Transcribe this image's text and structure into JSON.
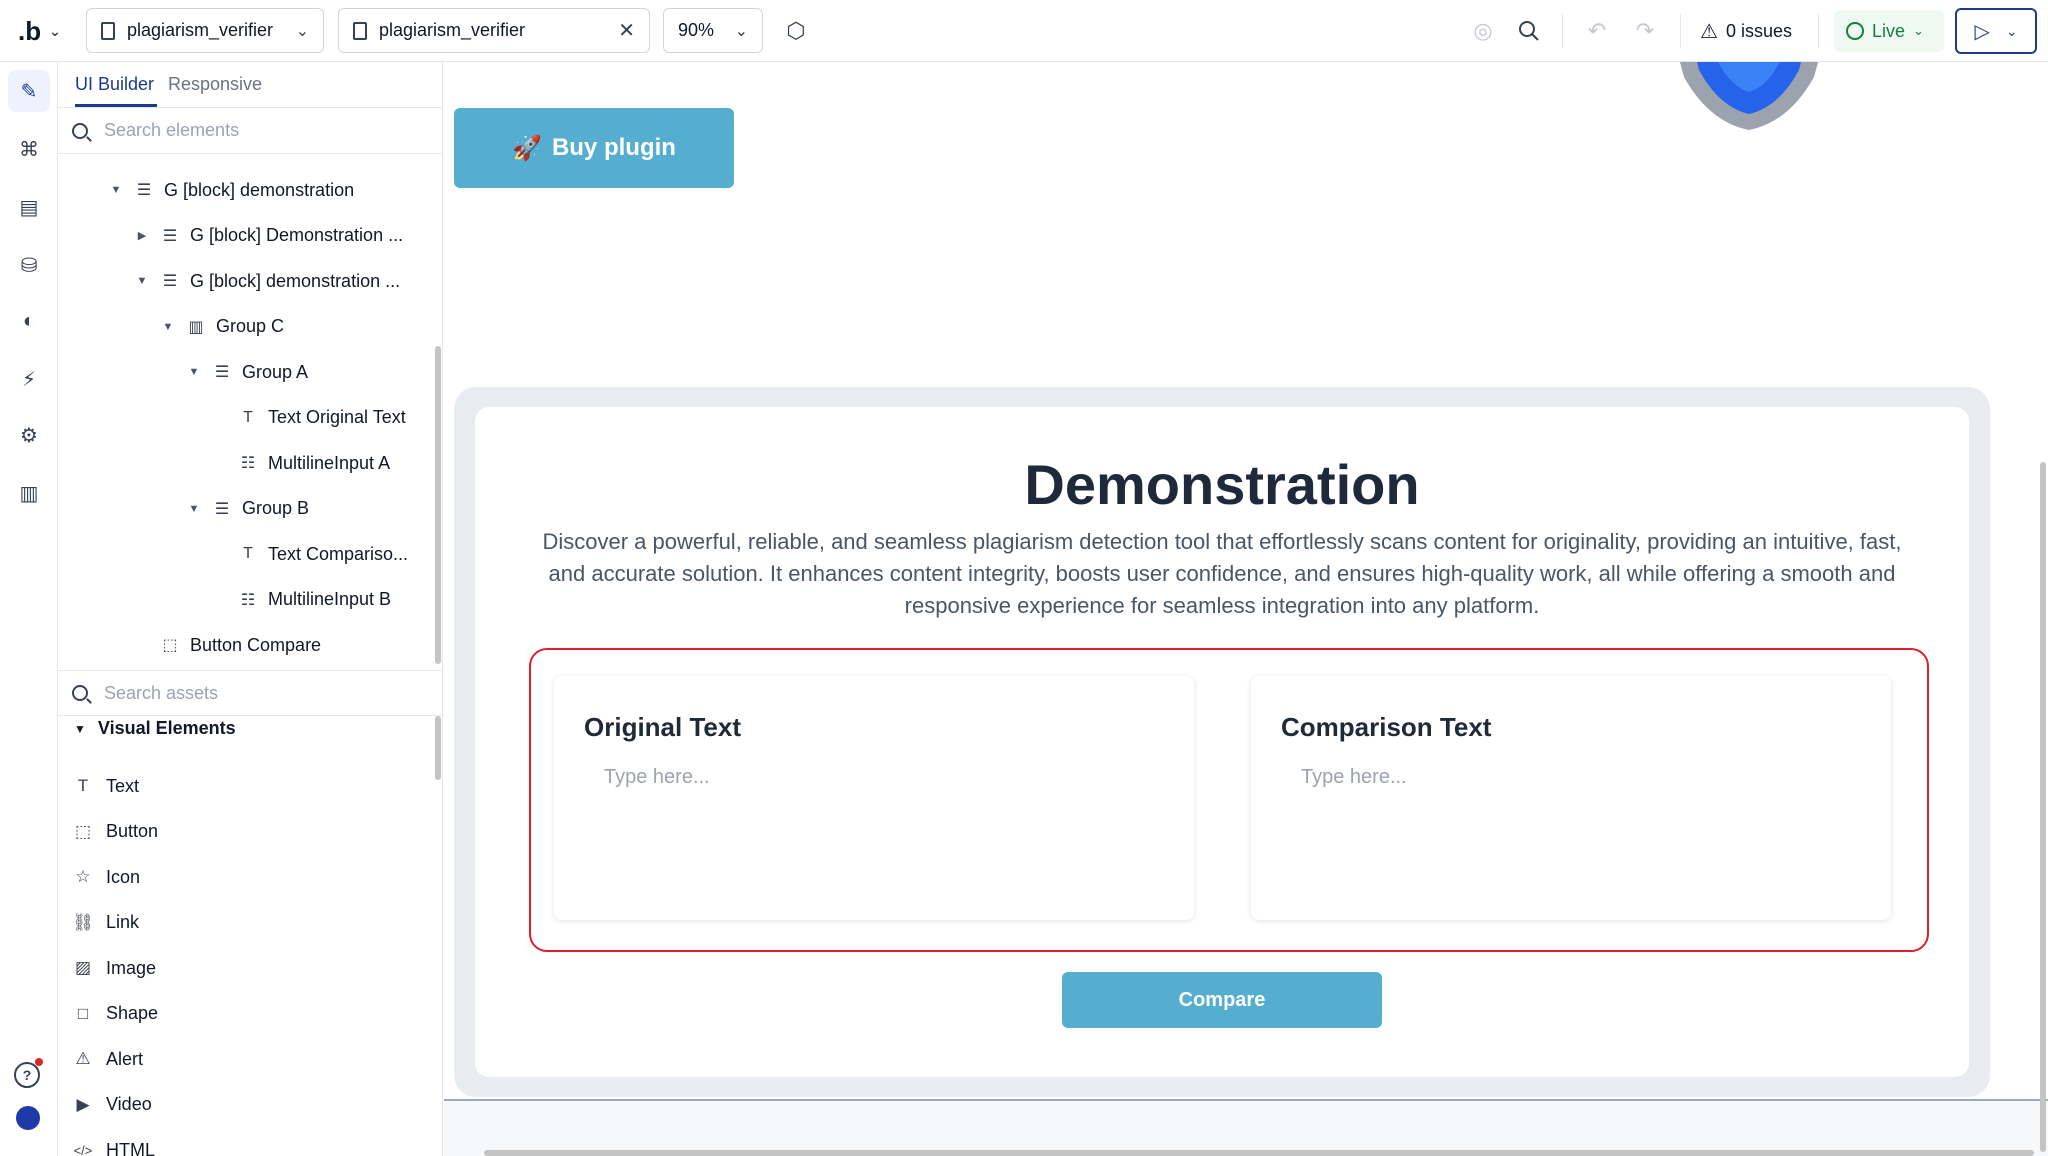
{
  "topbar": {
    "logo": ".b",
    "page_select": "plagiarism_verifier",
    "open_file": "plagiarism_verifier",
    "zoom": "90%",
    "issues": "0 issues",
    "live": "Live"
  },
  "panel": {
    "tabs": [
      "UI Builder",
      "Responsive"
    ],
    "search_elements_placeholder": "Search elements",
    "tree": [
      {
        "label": "G [block] demonstration",
        "depth": 0,
        "caret": "down",
        "icon": "block-icon"
      },
      {
        "label": "G [block] Demonstration ...",
        "depth": 1,
        "caret": "right",
        "icon": "block-icon"
      },
      {
        "label": "G [block] demonstration ...",
        "depth": 1,
        "caret": "down",
        "icon": "block-icon"
      },
      {
        "label": "Group C",
        "depth": 2,
        "caret": "down",
        "icon": "columns-icon"
      },
      {
        "label": "Group A",
        "depth": 3,
        "caret": "down",
        "icon": "block-icon"
      },
      {
        "label": "Text Original Text",
        "depth": 4,
        "caret": "",
        "icon": "text-icon"
      },
      {
        "label": "MultilineInput A",
        "depth": 4,
        "caret": "",
        "icon": "multiline-icon"
      },
      {
        "label": "Group B",
        "depth": 3,
        "caret": "down",
        "icon": "block-icon"
      },
      {
        "label": "Text Compariso...",
        "depth": 4,
        "caret": "",
        "icon": "text-icon"
      },
      {
        "label": "MultilineInput B",
        "depth": 4,
        "caret": "",
        "icon": "multiline-icon"
      },
      {
        "label": "Button Compare",
        "depth": 1,
        "caret": "",
        "icon": "button-icon"
      }
    ],
    "search_assets_placeholder": "Search assets",
    "section_title": "Visual Elements",
    "assets": [
      {
        "label": "Text",
        "icon": "text-icon"
      },
      {
        "label": "Button",
        "icon": "button-icon"
      },
      {
        "label": "Icon",
        "icon": "star-icon"
      },
      {
        "label": "Link",
        "icon": "link-icon"
      },
      {
        "label": "Image",
        "icon": "image-icon"
      },
      {
        "label": "Shape",
        "icon": "square-icon"
      },
      {
        "label": "Alert",
        "icon": "alert-icon"
      },
      {
        "label": "Video",
        "icon": "video-icon"
      },
      {
        "label": "HTML",
        "icon": "code-icon"
      }
    ]
  },
  "canvas": {
    "buy_button": "Buy plugin",
    "title": "Demonstration",
    "description": "Discover a powerful, reliable, and seamless plagiarism detection tool that effortlessly scans content for originality, providing an intuitive, fast, and accurate solution. It enhances content integrity, boosts user confidence, and ensures high-quality work, all while offering a smooth and responsive experience for seamless integration into any platform.",
    "card_a_title": "Original Text",
    "card_a_placeholder": "Type here...",
    "card_b_title": "Comparison Text",
    "card_b_placeholder": "Type here...",
    "compare_button": "Compare",
    "accent_color": "#55aed0",
    "highlight_color": "#e11d2a"
  }
}
